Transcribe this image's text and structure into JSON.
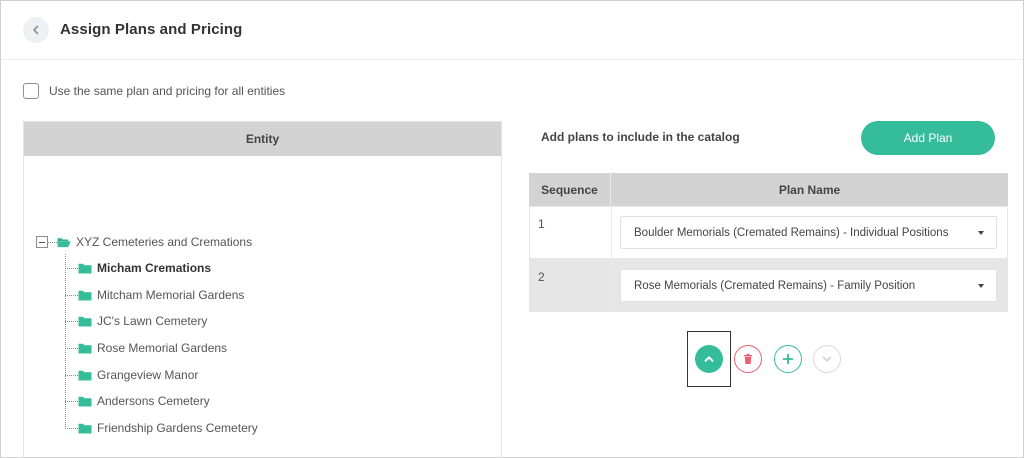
{
  "header": {
    "title": "Assign Plans and Pricing",
    "back_icon": "chevron-left-icon"
  },
  "options": {
    "same_plan_label": "Use the same plan and pricing for all entities",
    "same_plan_checked": false
  },
  "entity_panel": {
    "header": "Entity",
    "root": {
      "label": "XYZ Cemeteries and Cremations",
      "icon": "folder-open-icon",
      "expanded": true
    },
    "children": [
      {
        "label": "Micham Cremations",
        "selected": true
      },
      {
        "label": "Mitcham Memorial Gardens",
        "selected": false
      },
      {
        "label": "JC's Lawn Cemetery",
        "selected": false
      },
      {
        "label": "Rose Memorial Gardens",
        "selected": false
      },
      {
        "label": "Grangeview Manor",
        "selected": false
      },
      {
        "label": "Andersons Cemetery",
        "selected": false
      },
      {
        "label": "Friendship Gardens Cemetery",
        "selected": false
      }
    ]
  },
  "plans": {
    "intro": "Add plans to include in the catalog",
    "add_button": "Add Plan",
    "columns": [
      "Sequence",
      "Plan Name"
    ],
    "rows": [
      {
        "sequence": "1",
        "plan": "Boulder Memorials (Cremated Remains) - Individual Positions"
      },
      {
        "sequence": "2",
        "plan": "Rose Memorials (Cremated Remains) - Family Position"
      }
    ],
    "selected_row": 2
  },
  "actions": {
    "move_up_icon": "chevron-up-icon",
    "delete_icon": "trash-icon",
    "add_icon": "plus-icon",
    "move_down_icon": "chevron-down-icon"
  },
  "colors": {
    "accent": "#35bc9a",
    "danger": "#ef5b6e",
    "header_gray": "#d3d3d3"
  }
}
